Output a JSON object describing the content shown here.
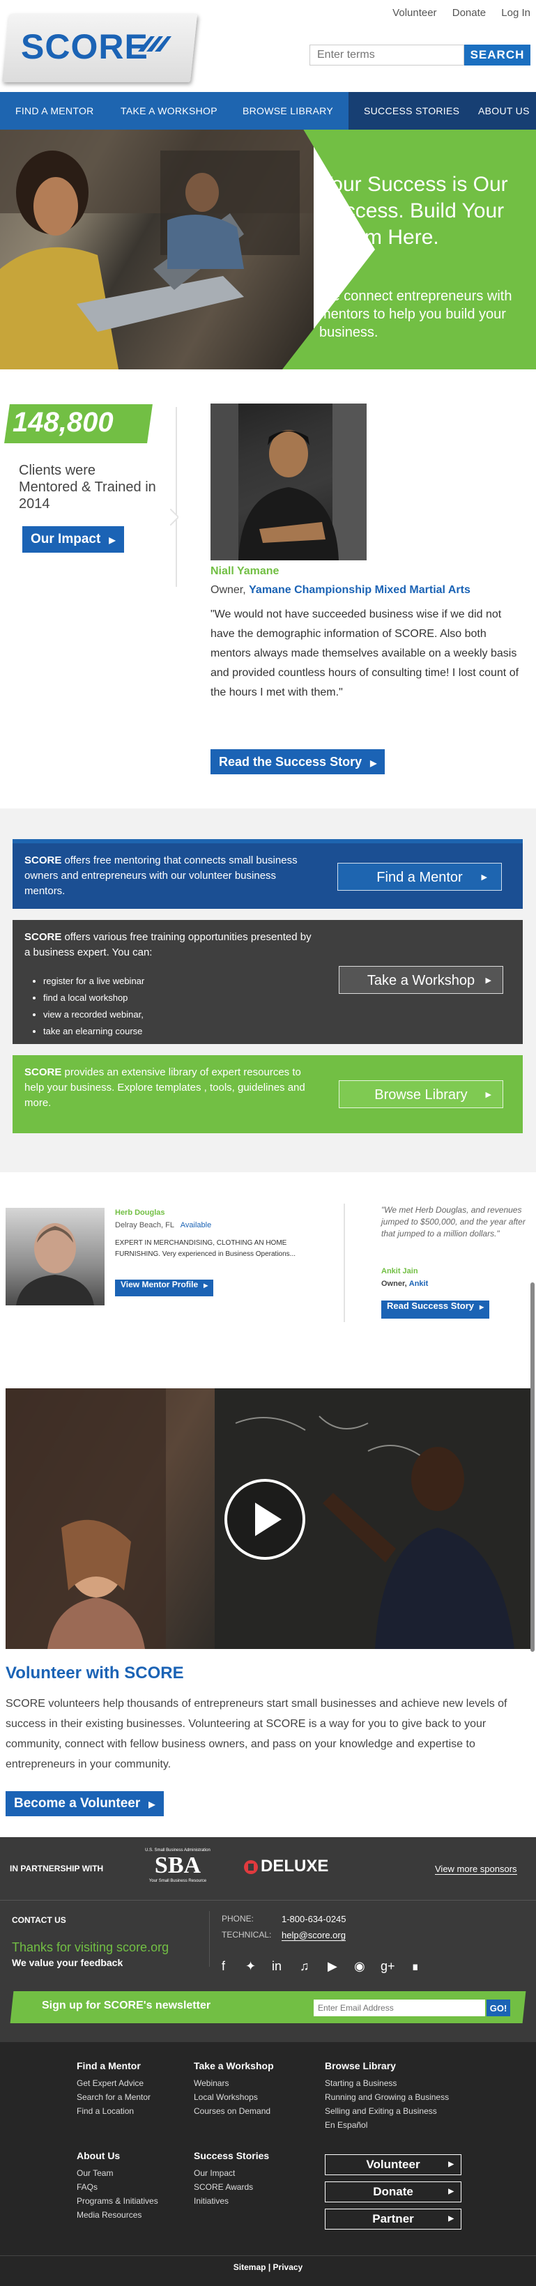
{
  "header": {
    "logo_text": "SCORE",
    "utility_links": [
      "Volunteer",
      "Donate",
      "Log In"
    ],
    "search_placeholder": "Enter terms",
    "search_button": "SEARCH"
  },
  "nav": {
    "items": [
      "FIND A MENTOR",
      "TAKE A WORKSHOP",
      "BROWSE LIBRARY",
      "SUCCESS STORIES",
      "ABOUT US"
    ]
  },
  "hero": {
    "headline": "Your Success is Our Success. Build Your Dream Here.",
    "subhead": "We connect entrepreneurs with mentors to help you build your business."
  },
  "impact": {
    "stat": "148,800",
    "label": "Clients were Mentored & Trained in 2014",
    "button": "Our Impact"
  },
  "story": {
    "name": "Niall Yamane",
    "owner_prefix": "Owner,",
    "company": "Yamane Championship Mixed Martial Arts",
    "quote": "\"We would not have succeeded business wise if we did not have the demographic information of SCORE. Also both mentors always made themselves available on a weekly basis and provided countless hours of consulting time! I lost count of the hours I met with them.\"",
    "button": "Read the Success Story"
  },
  "services": {
    "brand": "SCORE",
    "mentor_text": " offers free mentoring that connects small business owners and entrepreneurs with our volunteer business mentors.",
    "mentor_button": "Find a Mentor",
    "workshop_text": " offers various free training opportunities presented by a business expert. You can:",
    "workshop_bullets": [
      "register for a live webinar",
      "find a local workshop",
      "view a recorded webinar,",
      "take an elearning course"
    ],
    "workshop_button": "Take a Workshop",
    "library_text": " provides an extensive library of expert resources to help your business. Explore templates , tools, guidelines and more.",
    "library_button": "Browse Library"
  },
  "mentor_profile": {
    "name": "Herb Douglas",
    "location": "Delray Beach, FL",
    "availability": "Available",
    "expertise": "EXPERT IN MERCHANDISING, CLOTHING AN HOME FURNISHING. Very experienced in Business Operations...",
    "button": "View Mentor Profile"
  },
  "testimonial": {
    "quote": "\"We met Herb Douglas, and revenues jumped to $500,000, and the year after that jumped to a million dollars.\"",
    "name": "Ankit Jain",
    "owner_prefix": "Owner,",
    "company": "Ankit",
    "button": "Read Success Story"
  },
  "volunteer": {
    "title": "Volunteer with SCORE",
    "body": "SCORE volunteers help thousands of entrepreneurs start small businesses and achieve new levels of success in their existing businesses. Volunteering at SCORE is a way for you to give back to your community, connect with fellow business owners, and pass on your knowledge and expertise to entrepreneurs in your community.",
    "button": "Become a Volunteer"
  },
  "partners": {
    "label": "IN PARTNERSHIP WITH",
    "sba_top": "U.S. Small Business Administration",
    "sba_logo": "SBA",
    "sba_tagline": "Your Small Business Resource",
    "deluxe": "DELUXE",
    "more_link": "View more sponsors"
  },
  "contact": {
    "heading": "CONTACT US",
    "thanks": "Thanks for visiting score.org",
    "feedback": "We value your feedback",
    "phone_label": "PHONE:",
    "phone": "1-800-634-0245",
    "tech_label": "TECHNICAL:",
    "tech_email": "help@score.org"
  },
  "newsletter": {
    "label": "Sign up for SCORE's newsletter",
    "placeholder": "Enter Email Address",
    "button": "GO!"
  },
  "footer": {
    "col1_title": "Find a Mentor",
    "col1_links": [
      "Get Expert Advice",
      "Search for a Mentor",
      "Find a Location"
    ],
    "col2_title": "Take a Workshop",
    "col2_links": [
      "Webinars",
      "Local Workshops",
      "Courses on Demand"
    ],
    "col3_title": "Browse Library",
    "col3_links": [
      "Starting a Business",
      "Running and Growing a Business",
      "Selling and Exiting a Business",
      "En Español"
    ],
    "col4_title": "About Us",
    "col4_links": [
      "Our Team",
      "FAQs",
      "Programs & Initiatives",
      "Media Resources"
    ],
    "col5_title": "Success Stories",
    "col5_links": [
      "Our Impact",
      "SCORE Awards",
      "Initiatives"
    ],
    "buttons": [
      "Volunteer",
      "Donate",
      "Partner"
    ],
    "bottom_links": [
      "Sitemap",
      "Privacy"
    ],
    "bottom_sep": "|"
  },
  "colors": {
    "brand_blue": "#1b63b5",
    "brand_green": "#72bf44",
    "nav_dark": "#173f73",
    "footer_dark": "#3a3a3a"
  }
}
